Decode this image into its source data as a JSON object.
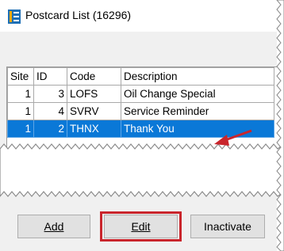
{
  "window": {
    "title": "Postcard List (16296)",
    "icon": "app-list-icon"
  },
  "table": {
    "columns": [
      "Site",
      "ID",
      "Code",
      "Description"
    ],
    "rows": [
      {
        "site": "1",
        "id": "3",
        "code": "LOFS",
        "description": "Oil Change Special",
        "selected": false
      },
      {
        "site": "1",
        "id": "4",
        "code": "SVRV",
        "description": "Service Reminder",
        "selected": false
      },
      {
        "site": "1",
        "id": "2",
        "code": "THNX",
        "description": "Thank You",
        "selected": true
      }
    ]
  },
  "buttons": {
    "add_label": "Add",
    "edit_label": "Edit",
    "inactivate_label": "Inactivate"
  },
  "colors": {
    "selection": "#0a78d7",
    "callout": "#c9252c"
  }
}
